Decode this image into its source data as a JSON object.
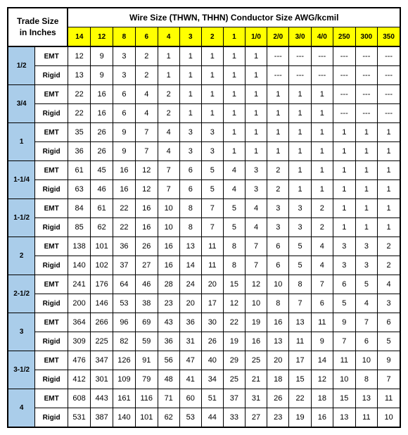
{
  "title_line1": "Trade Size",
  "title_line2": "in Inches",
  "wire_title": "Wire Size (THWN, THHN) Conductor Size AWG/kcmil",
  "wire_sizes": [
    "14",
    "12",
    "8",
    "6",
    "4",
    "3",
    "2",
    "1",
    "1/0",
    "2/0",
    "3/0",
    "4/0",
    "250",
    "300",
    "350"
  ],
  "rows": [
    {
      "trade": "1/2",
      "type": "EMT",
      "vals": [
        "12",
        "9",
        "3",
        "2",
        "1",
        "1",
        "1",
        "1",
        "1",
        "---",
        "---",
        "---",
        "---",
        "---",
        "---"
      ]
    },
    {
      "trade": "1/2",
      "type": "Rigid",
      "vals": [
        "13",
        "9",
        "3",
        "2",
        "1",
        "1",
        "1",
        "1",
        "1",
        "---",
        "---",
        "---",
        "---",
        "---",
        "---"
      ]
    },
    {
      "trade": "3/4",
      "type": "EMT",
      "vals": [
        "22",
        "16",
        "6",
        "4",
        "2",
        "1",
        "1",
        "1",
        "1",
        "1",
        "1",
        "1",
        "---",
        "---",
        "---"
      ]
    },
    {
      "trade": "3/4",
      "type": "Rigid",
      "vals": [
        "22",
        "16",
        "6",
        "4",
        "2",
        "1",
        "1",
        "1",
        "1",
        "1",
        "1",
        "1",
        "---",
        "---",
        "---"
      ]
    },
    {
      "trade": "1",
      "type": "EMT",
      "vals": [
        "35",
        "26",
        "9",
        "7",
        "4",
        "3",
        "3",
        "1",
        "1",
        "1",
        "1",
        "1",
        "1",
        "1",
        "1"
      ]
    },
    {
      "trade": "1",
      "type": "Rigid",
      "vals": [
        "36",
        "26",
        "9",
        "7",
        "4",
        "3",
        "3",
        "1",
        "1",
        "1",
        "1",
        "1",
        "1",
        "1",
        "1"
      ]
    },
    {
      "trade": "1-1/4",
      "type": "EMT",
      "vals": [
        "61",
        "45",
        "16",
        "12",
        "7",
        "6",
        "5",
        "4",
        "3",
        "2",
        "1",
        "1",
        "1",
        "1",
        "1"
      ]
    },
    {
      "trade": "1-1/4",
      "type": "Rigid",
      "vals": [
        "63",
        "46",
        "16",
        "12",
        "7",
        "6",
        "5",
        "4",
        "3",
        "2",
        "1",
        "1",
        "1",
        "1",
        "1"
      ]
    },
    {
      "trade": "1-1/2",
      "type": "EMT",
      "vals": [
        "84",
        "61",
        "22",
        "16",
        "10",
        "8",
        "7",
        "5",
        "4",
        "3",
        "3",
        "2",
        "1",
        "1",
        "1"
      ]
    },
    {
      "trade": "1-1/2",
      "type": "Rigid",
      "vals": [
        "85",
        "62",
        "22",
        "16",
        "10",
        "8",
        "7",
        "5",
        "4",
        "3",
        "3",
        "2",
        "1",
        "1",
        "1"
      ]
    },
    {
      "trade": "2",
      "type": "EMT",
      "vals": [
        "138",
        "101",
        "36",
        "26",
        "16",
        "13",
        "11",
        "8",
        "7",
        "6",
        "5",
        "4",
        "3",
        "3",
        "2"
      ]
    },
    {
      "trade": "2",
      "type": "Rigid",
      "vals": [
        "140",
        "102",
        "37",
        "27",
        "16",
        "14",
        "11",
        "8",
        "7",
        "6",
        "5",
        "4",
        "3",
        "3",
        "2"
      ]
    },
    {
      "trade": "2-1/2",
      "type": "EMT",
      "vals": [
        "241",
        "176",
        "64",
        "46",
        "28",
        "24",
        "20",
        "15",
        "12",
        "10",
        "8",
        "7",
        "6",
        "5",
        "4"
      ]
    },
    {
      "trade": "2-1/2",
      "type": "Rigid",
      "vals": [
        "200",
        "146",
        "53",
        "38",
        "23",
        "20",
        "17",
        "12",
        "10",
        "8",
        "7",
        "6",
        "5",
        "4",
        "3"
      ]
    },
    {
      "trade": "3",
      "type": "EMT",
      "vals": [
        "364",
        "266",
        "96",
        "69",
        "43",
        "36",
        "30",
        "22",
        "19",
        "16",
        "13",
        "11",
        "9",
        "7",
        "6"
      ]
    },
    {
      "trade": "3",
      "type": "Rigid",
      "vals": [
        "309",
        "225",
        "82",
        "59",
        "36",
        "31",
        "26",
        "19",
        "16",
        "13",
        "11",
        "9",
        "7",
        "6",
        "5"
      ]
    },
    {
      "trade": "3-1/2",
      "type": "EMT",
      "vals": [
        "476",
        "347",
        "126",
        "91",
        "56",
        "47",
        "40",
        "29",
        "25",
        "20",
        "17",
        "14",
        "11",
        "10",
        "9"
      ]
    },
    {
      "trade": "3-1/2",
      "type": "Rigid",
      "vals": [
        "412",
        "301",
        "109",
        "79",
        "48",
        "41",
        "34",
        "25",
        "21",
        "18",
        "15",
        "12",
        "10",
        "8",
        "7"
      ]
    },
    {
      "trade": "4",
      "type": "EMT",
      "vals": [
        "608",
        "443",
        "161",
        "116",
        "71",
        "60",
        "51",
        "37",
        "31",
        "26",
        "22",
        "18",
        "15",
        "13",
        "11"
      ]
    },
    {
      "trade": "4",
      "type": "Rigid",
      "vals": [
        "531",
        "387",
        "140",
        "101",
        "62",
        "53",
        "44",
        "33",
        "27",
        "23",
        "19",
        "16",
        "13",
        "11",
        "10"
      ]
    }
  ]
}
